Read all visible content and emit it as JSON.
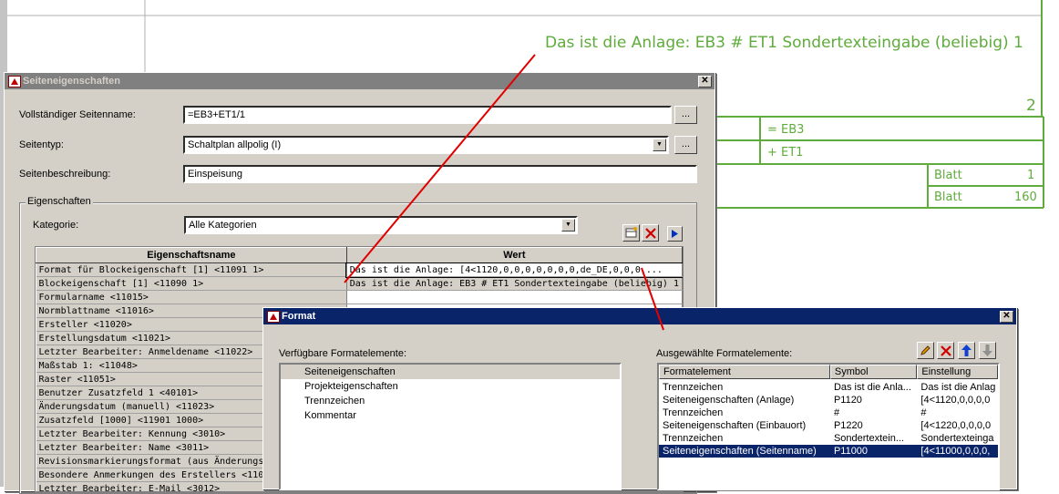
{
  "drawing": {
    "annotation": "Das ist die Anlage: EB3 # ET1 Sondertexteingabe (beliebig) 1",
    "page_number": "2",
    "anlage": "= EB3",
    "einbauort": "+ ET1",
    "blatt_label_1": "Blatt",
    "blatt_value_1": "1",
    "blatt_label_2": "Blatt",
    "blatt_value_2": "160",
    "line_color": "#5fac3c",
    "arrow_color": "#e00000"
  },
  "page_properties_dialog": {
    "title": "Seiteneigenschaften",
    "full_page_name_label": "Vollständiger Seitenname:",
    "full_page_name_value": "=EB3+ET1/1",
    "page_type_label": "Seitentyp:",
    "page_type_value": "Schaltplan allpolig (I)",
    "page_description_label": "Seitenbeschreibung:",
    "page_description_value": "Einspeisung",
    "ellipsis": "...",
    "properties_group": "Eigenschaften",
    "category_label": "Kategorie:",
    "category_value": "Alle Kategorien",
    "grid": {
      "col_name": "Eigenschaftsname",
      "col_value": "Wert",
      "rows": [
        {
          "name": "Format für Blockeigenschaft [1] <11091 1>",
          "value": "Das ist die Anlage: [4<1120,0,0,0,0,0,0,0,de_DE,0,0,0,..."
        },
        {
          "name": "Blockeigenschaft [1] <11090 1>",
          "value": "Das ist die Anlage: EB3 # ET1 Sondertexteingabe (beliebig) 1"
        },
        {
          "name": "Formularname <11015>",
          "value": ""
        },
        {
          "name": "Normblattname <11016>",
          "value": ""
        },
        {
          "name": "Ersteller <11020>",
          "value": ""
        },
        {
          "name": "Erstellungsdatum <11021>",
          "value": ""
        },
        {
          "name": "Letzter Bearbeiter: Anmeldename <11022>",
          "value": ""
        },
        {
          "name": "Maßstab 1: <11048>",
          "value": ""
        },
        {
          "name": "Raster <11051>",
          "value": ""
        },
        {
          "name": "Benutzer Zusatzfeld 1 <40101>",
          "value": ""
        },
        {
          "name": "Änderungsdatum (manuell) <11023>",
          "value": ""
        },
        {
          "name": "Zusatzfeld [1000] <11901 1000>",
          "value": ""
        },
        {
          "name": "Letzter Bearbeiter: Kennung <3010>",
          "value": ""
        },
        {
          "name": "Letzter Bearbeiter: Name <3011>",
          "value": ""
        },
        {
          "name": "Revisionsmarkierungsformat (aus Änderungsverfolg",
          "value": ""
        },
        {
          "name": "Besondere Anmerkungen des Erstellers <11059>",
          "value": ""
        },
        {
          "name": "Letzter Bearbeiter: E-Mail <3012>",
          "value": ""
        }
      ]
    }
  },
  "format_dialog": {
    "title": "Format",
    "available_label": "Verfügbare Formatelemente:",
    "available_items": [
      "Seiteneigenschaften",
      "Projekteigenschaften",
      "Trennzeichen",
      "Kommentar"
    ],
    "selected_label": "Ausgewählte Formatelemente:",
    "columns": [
      "Formatelement",
      "Symbol",
      "Einstellung"
    ],
    "rows": [
      {
        "element": "Trennzeichen",
        "symbol": "Das ist die Anla...",
        "setting": "Das ist die Anlag"
      },
      {
        "element": "Seiteneigenschaften (Anlage)",
        "symbol": "P1120",
        "setting": "[4<1120,0,0,0,0"
      },
      {
        "element": "Trennzeichen",
        "symbol": " #",
        "setting": " #"
      },
      {
        "element": "Seiteneigenschaften (Einbauort)",
        "symbol": "P1220",
        "setting": "[4<1220,0,0,0,0"
      },
      {
        "element": "Trennzeichen",
        "symbol": " Sondertextein...",
        "setting": " Sondertexteinga"
      },
      {
        "element": "Seiteneigenschaften (Seitenname)",
        "symbol": "P11000",
        "setting": "[4<11000,0,0,0,"
      }
    ],
    "selected_row_color": "#0a246a"
  }
}
